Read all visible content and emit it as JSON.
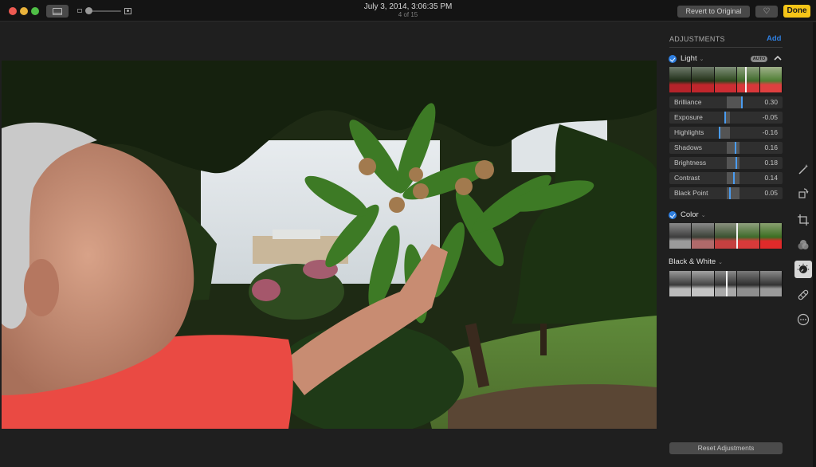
{
  "window": {
    "title": "July 3, 2014, 3:06:35 PM",
    "subtitle": "4 of 15",
    "buttons": {
      "revert": "Revert to Original",
      "favorite_icon": "heart-icon",
      "done": "Done"
    },
    "colors": {
      "accent": "#2f7fe0",
      "done": "#f5c518",
      "slider_knob": "#4a9cf0",
      "background": "#1f1f1f"
    }
  },
  "toolbar": {
    "view_toggle_icon": "single-photo-view-icon",
    "zoom_slider_min_icon": "thumbnail-small-icon",
    "zoom_slider_max_icon": "photo-large-icon",
    "zoom_level": 0
  },
  "photo": {
    "description": "Man in red shirt reaching toward buckeye tree branch in park"
  },
  "adjustments": {
    "heading": "ADJUSTMENTS",
    "add_label": "Add",
    "sections": {
      "light": {
        "label": "Light",
        "enabled": true,
        "auto_label": "AUTO",
        "strip_position": 0.67,
        "sliders": [
          {
            "label": "Brilliance",
            "value": "0.30",
            "amount": 0.3
          },
          {
            "label": "Exposure",
            "value": "-0.05",
            "amount": -0.05
          },
          {
            "label": "Highlights",
            "value": "-0.16",
            "amount": -0.16
          },
          {
            "label": "Shadows",
            "value": "0.16",
            "amount": 0.16
          },
          {
            "label": "Brightness",
            "value": "0.18",
            "amount": 0.18
          },
          {
            "label": "Contrast",
            "value": "0.14",
            "amount": 0.14
          },
          {
            "label": "Black Point",
            "value": "0.05",
            "amount": 0.05
          }
        ]
      },
      "color": {
        "label": "Color",
        "enabled": true,
        "strip_position": 0.59
      },
      "bw": {
        "label": "Black & White",
        "enabled": false,
        "strip_position": 0.5
      }
    },
    "reset_label": "Reset Adjustments"
  },
  "tools": [
    {
      "name": "enhance",
      "icon": "magic-wand-icon"
    },
    {
      "name": "rotate",
      "icon": "rotate-icon"
    },
    {
      "name": "crop",
      "icon": "crop-icon"
    },
    {
      "name": "filters",
      "icon": "filters-icon"
    },
    {
      "name": "adjust",
      "icon": "adjust-dial-icon",
      "active": true
    },
    {
      "name": "retouch",
      "icon": "bandage-icon"
    },
    {
      "name": "extensions",
      "icon": "more-icon"
    }
  ]
}
